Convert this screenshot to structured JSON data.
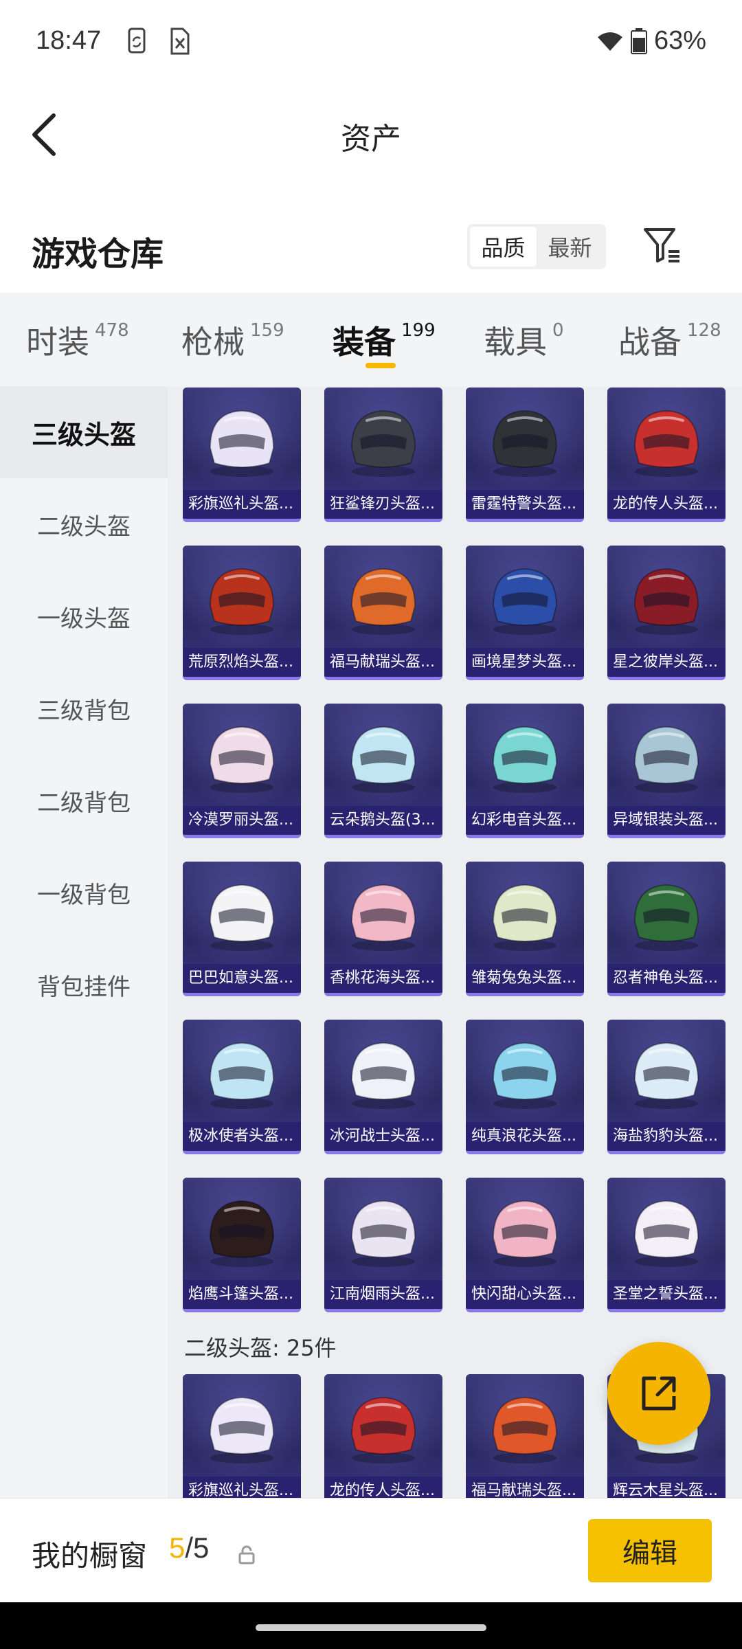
{
  "status_bar": {
    "time": "18:47",
    "battery": "63%"
  },
  "header": {
    "title": "资产"
  },
  "warehouse": {
    "title": "游戏仓库",
    "sort_options": [
      "品质",
      "最新"
    ],
    "active_sort": "品质"
  },
  "tabs": [
    {
      "label": "时装",
      "count": "478"
    },
    {
      "label": "枪械",
      "count": "159"
    },
    {
      "label": "装备",
      "count": "199",
      "active": true
    },
    {
      "label": "载具",
      "count": "0"
    },
    {
      "label": "战备",
      "count": "128"
    }
  ],
  "sidebar": [
    {
      "label": "三级头盔",
      "active": true
    },
    {
      "label": "二级头盔"
    },
    {
      "label": "一级头盔"
    },
    {
      "label": "三级背包"
    },
    {
      "label": "二级背包"
    },
    {
      "label": "一级背包"
    },
    {
      "label": "背包挂件"
    }
  ],
  "items": [
    {
      "name": "彩旗巡礼头盔...",
      "color": "#e8e4f6"
    },
    {
      "name": "狂鲨锋刃头盔...",
      "color": "#3c3f48"
    },
    {
      "name": "雷霆特警头盔...",
      "color": "#2f3338"
    },
    {
      "name": "龙的传人头盔...",
      "color": "#c8302e"
    },
    {
      "name": "荒原烈焰头盔...",
      "color": "#b8321c"
    },
    {
      "name": "福马献瑞头盔...",
      "color": "#e06a2a"
    },
    {
      "name": "画境星梦头盔...",
      "color": "#2b4fa8"
    },
    {
      "name": "星之彼岸头盔...",
      "color": "#8a1c28"
    },
    {
      "name": "冷漠罗丽头盔...",
      "color": "#f0dce8"
    },
    {
      "name": "云朵鹅头盔(3...",
      "color": "#bfe6f2"
    },
    {
      "name": "幻彩电音头盔...",
      "color": "#7ad6d2"
    },
    {
      "name": "异域银装头盔...",
      "color": "#a9c6d6"
    },
    {
      "name": "巴巴如意头盔...",
      "color": "#f4f4f6"
    },
    {
      "name": "香桃花海头盔...",
      "color": "#f2b8c8"
    },
    {
      "name": "雏菊兔兔头盔...",
      "color": "#dfe8c8"
    },
    {
      "name": "忍者神龟头盔...",
      "color": "#2f6e3a"
    },
    {
      "name": "极冰使者头盔...",
      "color": "#bfe4f4"
    },
    {
      "name": "冰河战士头盔...",
      "color": "#eef2f8"
    },
    {
      "name": "纯真浪花头盔...",
      "color": "#8cd4ee"
    },
    {
      "name": "海盐豹豹头盔...",
      "color": "#dcecf6"
    },
    {
      "name": "焰鹰斗篷头盔...",
      "color": "#2c1c1c"
    },
    {
      "name": "江南烟雨头盔...",
      "color": "#eae4f2"
    },
    {
      "name": "快闪甜心头盔...",
      "color": "#f0b4c4"
    },
    {
      "name": "圣堂之誓头盔...",
      "color": "#f4eef6"
    }
  ],
  "section": {
    "label": "二级头盔: 25件"
  },
  "items2": [
    {
      "name": "彩旗巡礼头盔...",
      "color": "#ece8f8"
    },
    {
      "name": "龙的传人头盔...",
      "color": "#c8302e"
    },
    {
      "name": "福马献瑞头盔...",
      "color": "#e0582a"
    },
    {
      "name": "辉云木星头盔...",
      "color": "#dff0f0"
    }
  ],
  "showcase": {
    "label": "我的橱窗",
    "current": "5",
    "separator": "/",
    "total": "5",
    "edit_label": "编辑"
  }
}
